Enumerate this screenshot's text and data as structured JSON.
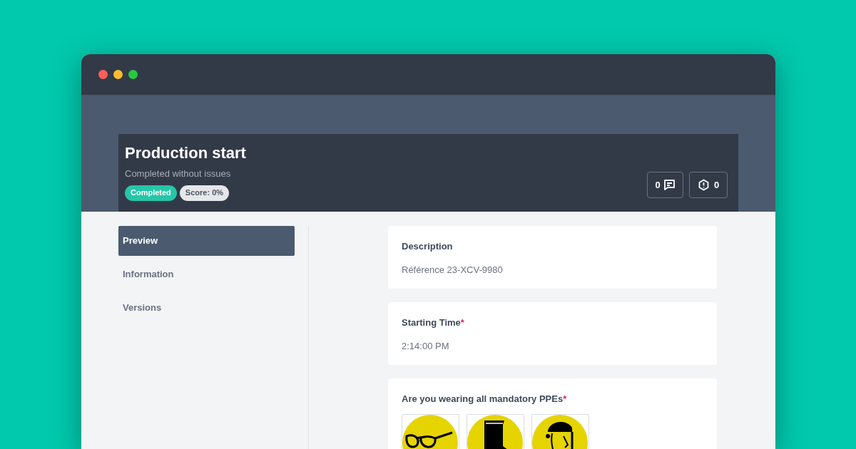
{
  "header": {
    "title": "Production start",
    "subtitle": "Completed without issues",
    "badges": [
      {
        "kind": "status",
        "label": "Completed"
      },
      {
        "kind": "score",
        "label": "Score: 0%"
      }
    ],
    "comments_count": "0",
    "issues_count": "0"
  },
  "sidebar": {
    "items": [
      {
        "label": "Preview",
        "selected": true
      },
      {
        "label": "Information",
        "selected": false
      },
      {
        "label": "Versions",
        "selected": false
      }
    ]
  },
  "fields": [
    {
      "kind": "text",
      "label": "Description",
      "value": "Référence 23-XCV-9980"
    },
    {
      "kind": "text",
      "label": "Starting Time",
      "required_mark": "*",
      "value": "2:14:00 PM"
    },
    {
      "kind": "ppe",
      "label": "Are you wearing all mandatory PPEs",
      "required_mark": "*",
      "items": [
        {
          "kind": "glasses"
        },
        {
          "kind": "boot"
        },
        {
          "kind": "face-shield"
        }
      ]
    }
  ]
}
